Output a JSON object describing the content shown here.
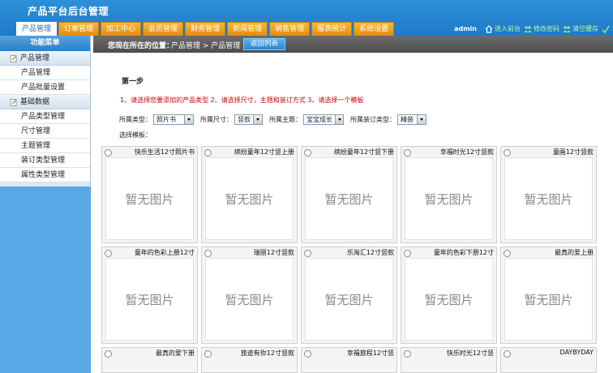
{
  "app": {
    "title": "产品平台后台管理"
  },
  "nav": {
    "tabs": [
      "产品管理",
      "订单管理",
      "加工中心",
      "会员管理",
      "财务管理",
      "新闻管理",
      "销售管理",
      "报表统计",
      "系统设置"
    ]
  },
  "toolbar": {
    "user": "admin",
    "front": "进入前台",
    "password": "修改密码",
    "cache": "清空缓存"
  },
  "sidebar": {
    "title": "功能菜单",
    "groups": [
      {
        "label": "产品管理",
        "items": [
          "产品管理",
          "产品批量设置"
        ]
      },
      {
        "label": "基础数据",
        "items": [
          "产品类型管理",
          "尺寸管理",
          "主题管理",
          "装订类型管理",
          "属性类型管理"
        ]
      }
    ]
  },
  "location": {
    "label": "您现在所在的位置：",
    "path": "产品管理 > 产品管理",
    "back_button": "返回列表"
  },
  "main": {
    "step_title": "第一步",
    "instructions": "1、请选择您要添加的产品类型 2、请选择尺寸，主题和装订方式 3、请选择一个模板",
    "filters": [
      {
        "label": "所属类型：",
        "value": "照片书"
      },
      {
        "label": "所属尺寸：",
        "value": "竖款"
      },
      {
        "label": "所属主题：",
        "value": "宝宝成长"
      },
      {
        "label": "所属装订类型：",
        "value": "精装"
      }
    ],
    "template_label": "选择模板：",
    "placeholder_text": "暂无图片",
    "templates": [
      "快乐生活12寸照片书",
      "缤纷童年12寸竖上册",
      "缤纷童年12寸竖下册",
      "幸福时光12寸竖款",
      "童画12寸竖款",
      "童年的色彩上册12寸",
      "瑞丽12寸竖款",
      "乐淘汇12寸竖款",
      "童年的色彩下册12寸",
      "最真的爱上册",
      "最真的爱下册",
      "旅途有你12寸竖款",
      "幸福旅程12寸竖",
      "快乐时光12寸竖",
      "DAYBYDAY"
    ]
  }
}
